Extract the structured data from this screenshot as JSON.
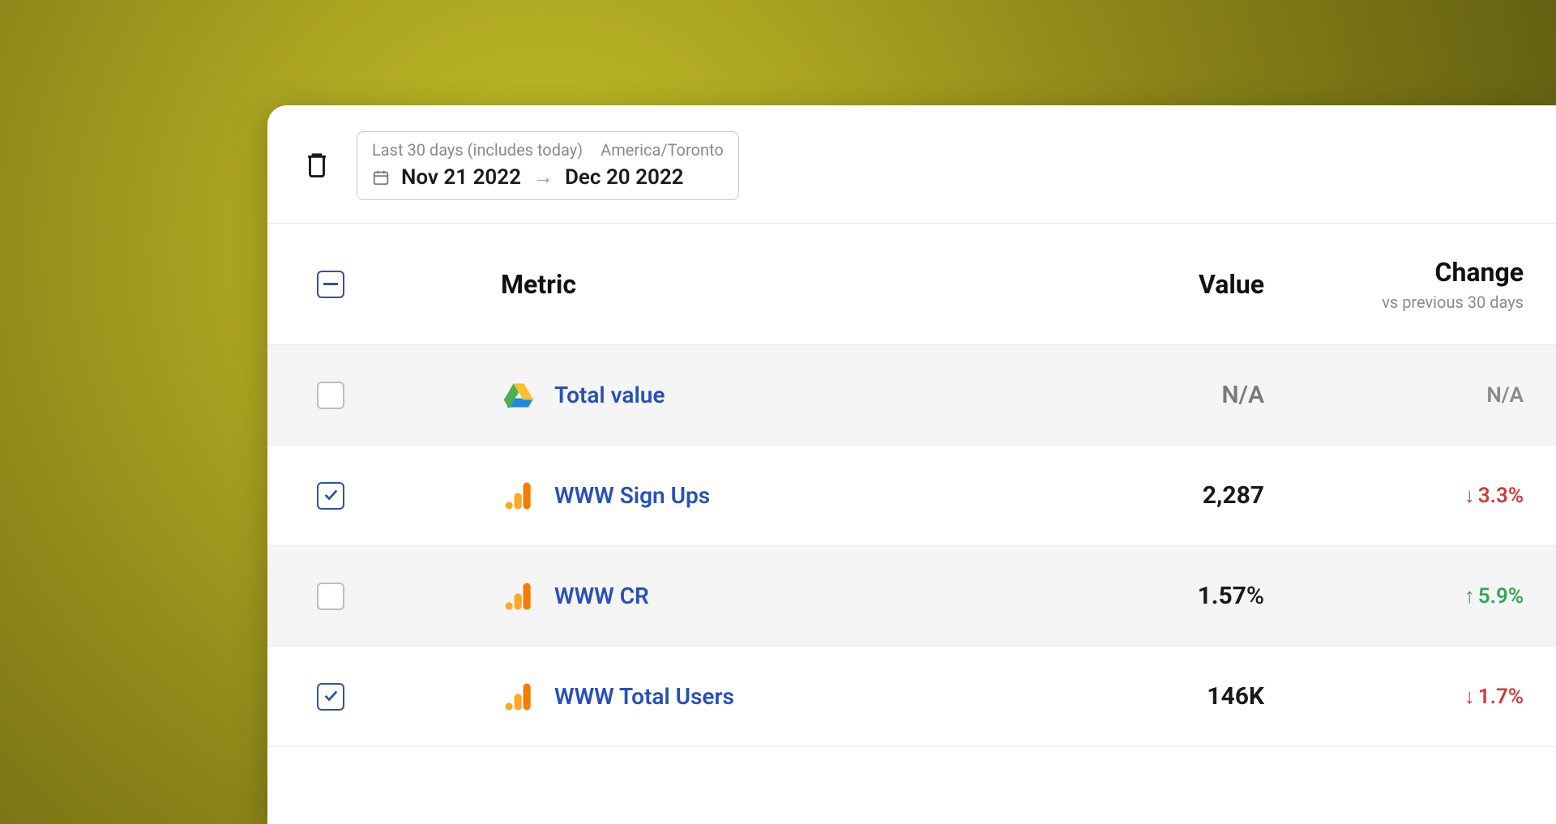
{
  "toolbar": {
    "date_picker": {
      "range_label": "Last 30 days (includes today)",
      "timezone": "America/Toronto",
      "start": "Nov 21 2022",
      "end": "Dec 20 2022"
    }
  },
  "table": {
    "headers": {
      "metric": "Metric",
      "value": "Value",
      "change": "Change",
      "change_sub": "vs previous 30 days"
    },
    "rows": [
      {
        "checked": false,
        "highlight": true,
        "icon": "google-drive",
        "name": "Total value",
        "value": "N/A",
        "value_is_na": true,
        "change": "N/A",
        "change_dir": "na"
      },
      {
        "checked": true,
        "highlight": false,
        "icon": "google-analytics",
        "name": "WWW Sign Ups",
        "value": "2,287",
        "value_is_na": false,
        "change": "3.3%",
        "change_dir": "down"
      },
      {
        "checked": false,
        "highlight": true,
        "icon": "google-analytics",
        "name": "WWW CR",
        "value": "1.57",
        "value_suffix": "%",
        "value_is_na": false,
        "change": "5.9%",
        "change_dir": "up"
      },
      {
        "checked": true,
        "highlight": false,
        "icon": "google-analytics",
        "name": "WWW Total Users",
        "value": "146K",
        "value_is_na": false,
        "change": "1.7%",
        "change_dir": "down"
      }
    ]
  }
}
